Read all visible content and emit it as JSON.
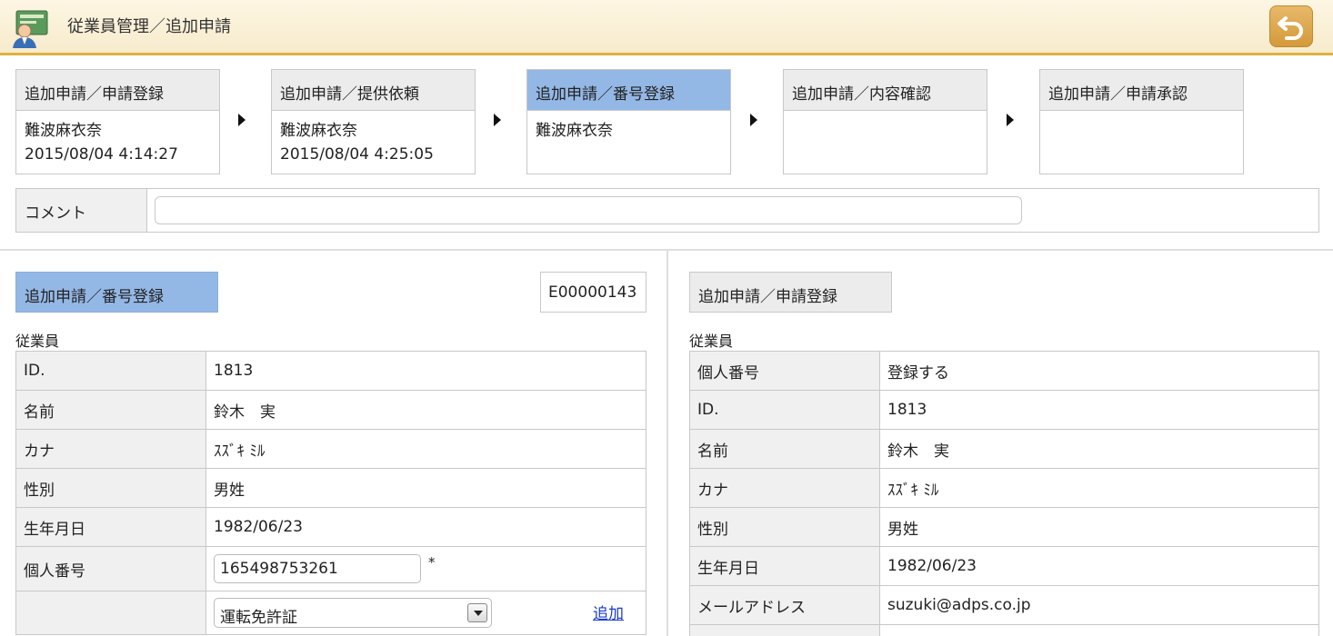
{
  "header": {
    "title": "従業員管理／追加申請",
    "back_icon": "undo-icon"
  },
  "steps": [
    {
      "title": "追加申請／申請登録",
      "name": "難波麻衣奈",
      "time": "2015/08/04 4:14:27"
    },
    {
      "title": "追加申請／提供依頼",
      "name": "難波麻衣奈",
      "time": "2015/08/04 4:25:05"
    },
    {
      "title": "追加申請／番号登録",
      "name": "難波麻衣奈",
      "time": ""
    },
    {
      "title": "追加申請／内容確認",
      "name": "",
      "time": ""
    },
    {
      "title": "追加申請／申請承認",
      "name": "",
      "time": ""
    }
  ],
  "comment": {
    "label": "コメント",
    "value": ""
  },
  "left_panel": {
    "tab": "追加申請／番号登録",
    "code": "E00000143",
    "group": "従業員",
    "rows": [
      {
        "label": "ID.",
        "value": "1813"
      },
      {
        "label": "名前",
        "value": "鈴木　実"
      },
      {
        "label": "カナ",
        "value": "ｽｽﾞｷ ﾐﾙ"
      },
      {
        "label": "性別",
        "value": "男姓"
      },
      {
        "label": "生年月日",
        "value": "1982/06/23"
      }
    ],
    "my_number": {
      "label": "個人番号",
      "value": "165498753261",
      "required_mark": "*"
    },
    "doc_select": {
      "label": "",
      "selected": "運転免許証",
      "add_link": "追加"
    }
  },
  "right_panel": {
    "tab": "追加申請／申請登録",
    "group": "従業員",
    "rows": [
      {
        "label": "個人番号",
        "value": "登録する"
      },
      {
        "label": "ID.",
        "value": "1813"
      },
      {
        "label": "名前",
        "value": "鈴木　実"
      },
      {
        "label": "カナ",
        "value": "ｽｽﾞｷ ﾐﾙ"
      },
      {
        "label": "性別",
        "value": "男姓"
      },
      {
        "label": "生年月日",
        "value": "1982/06/23"
      },
      {
        "label": "メールアドレス",
        "value": "suzuki@adps.co.jp"
      },
      {
        "label": "",
        "value": ""
      }
    ]
  },
  "colors": {
    "accent_blue": "#94b8e6",
    "header_border": "#e0b040",
    "back_button": "#d49a3a",
    "link": "#1a3ccc"
  }
}
